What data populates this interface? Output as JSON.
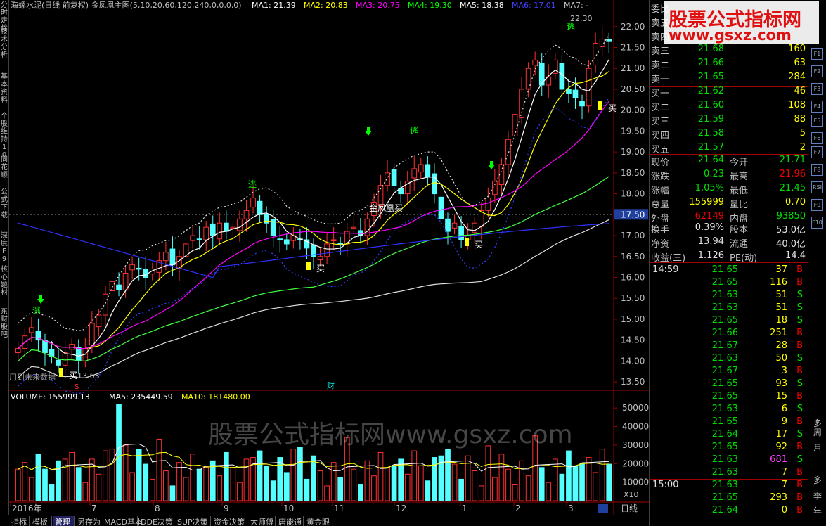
{
  "sidebar": {
    "tabs": [
      "分时走势",
      "技术分析",
      "基本资料",
      "个股维持10",
      "同花顺",
      "公式下载",
      "深度F9",
      "核心题材",
      "东财股吧"
    ]
  },
  "chart": {
    "title_line": "海螺水泥(日线 前复权) 金凤凰主图(5,10,20,60,120,240,0,0,0,0)",
    "ma_labels": [
      {
        "text": "MA1: 21.39",
        "color": "#ffffff"
      },
      {
        "text": "MA2: 20.83",
        "color": "#ffff00"
      },
      {
        "text": "MA3: 20.75",
        "color": "#ff00ff"
      },
      {
        "text": "MA4: 19.30",
        "color": "#00ff00"
      },
      {
        "text": "MA5: 18.38",
        "color": "#ffffff"
      },
      {
        "text": "MA6: 17.01",
        "color": "#4040ff"
      },
      {
        "text": "MA7: -",
        "color": "#c0c0c0"
      }
    ],
    "price_axis": [
      "22.00",
      "21.50",
      "21.00",
      "20.50",
      "20.00",
      "19.50",
      "19.00",
      "18.50",
      "18.00",
      "17.50",
      "17.00",
      "16.50",
      "16.00",
      "15.50",
      "15.00",
      "14.50",
      "14.00",
      "13.50"
    ],
    "current_price_tag": "17.50",
    "high_label": "22.30",
    "low_label": "13.63",
    "annotations": {
      "escape": "逃",
      "buy": "买",
      "phoenix_buy": "金凤凰买",
      "future_data": "用到未来数据",
      "finance_mark": "财",
      "s_mark": "S"
    },
    "volume_line": {
      "volume": "VOLUME: 155999.13",
      "ma5": "MA5: 235449.59",
      "ma10": "MA10: 181480.00"
    },
    "volume_axis": [
      "50000",
      "40000",
      "30000",
      "20000",
      "10000"
    ],
    "volume_unit": "X10",
    "time_axis": [
      "2016年",
      "7",
      "8",
      "9",
      "10",
      "11",
      "12",
      "1",
      "2",
      "3"
    ],
    "period": "日线",
    "overlay_text": "股票公式指标网www.gsxz.com"
  },
  "chart_data": {
    "type": "candlestick",
    "title": "海螺水泥(日线 前复权)",
    "ylim": [
      13.4,
      22.4
    ],
    "closes": [
      14.3,
      14.6,
      14.8,
      14.5,
      14.2,
      14.1,
      13.9,
      14.2,
      14.4,
      14.0,
      14.3,
      14.9,
      15.1,
      15.6,
      15.9,
      15.7,
      16.1,
      16.3,
      16.2,
      16.0,
      16.2,
      16.4,
      16.6,
      16.3,
      16.5,
      16.8,
      17.0,
      16.9,
      17.2,
      17.0,
      17.3,
      17.1,
      17.2,
      17.4,
      17.6,
      17.9,
      17.5,
      17.3,
      17.0,
      16.9,
      16.8,
      17.0,
      16.9,
      16.7,
      16.5,
      16.5,
      16.8,
      16.9,
      16.8,
      17.1,
      17.2,
      17.0,
      17.4,
      17.8,
      18.2,
      18.5,
      18.2,
      18.0,
      18.3,
      18.6,
      18.7,
      18.4,
      18.0,
      17.4,
      17.1,
      17.3,
      16.9,
      17.0,
      17.3,
      17.6,
      17.9,
      18.3,
      18.7,
      19.3,
      19.9,
      20.5,
      21.0,
      21.2,
      20.6,
      20.8,
      21.2,
      20.5,
      20.4,
      20.3,
      20.1,
      21.0,
      21.6,
      21.7,
      21.64
    ],
    "volume_axis_unit": "X10"
  },
  "orderbook": {
    "header_label": "委比",
    "asks": [
      {
        "label": "卖五",
        "price": "",
        "vol": ""
      },
      {
        "label": "卖四",
        "price": "",
        "vol": ""
      },
      {
        "label": "卖三",
        "price": "21.68",
        "vol": "160"
      },
      {
        "label": "卖二",
        "price": "21.66",
        "vol": "63"
      },
      {
        "label": "卖一",
        "price": "21.65",
        "vol": "284"
      }
    ],
    "bids": [
      {
        "label": "买一",
        "price": "21.62",
        "vol": "46"
      },
      {
        "label": "买二",
        "price": "21.60",
        "vol": "108"
      },
      {
        "label": "买三",
        "price": "21.59",
        "vol": "88"
      },
      {
        "label": "买四",
        "price": "21.58",
        "vol": "5"
      },
      {
        "label": "买五",
        "price": "21.57",
        "vol": "2"
      }
    ],
    "stats": [
      {
        "l1": "现价",
        "v1": "21.64",
        "c1": "grn",
        "l2": "今开",
        "v2": "21.71",
        "c2": "grn"
      },
      {
        "l1": "涨跌",
        "v1": "-0.23",
        "c1": "grn",
        "l2": "最高",
        "v2": "21.96",
        "c2": "ntr"
      },
      {
        "l1": "涨幅",
        "v1": "-1.05%",
        "c1": "grn",
        "l2": "最低",
        "v2": "21.45",
        "c2": "grn"
      },
      {
        "l1": "总量",
        "v1": "155999",
        "c1": "yel",
        "l2": "量比",
        "v2": "0.70",
        "c2": "yel"
      },
      {
        "l1": "外盘",
        "v1": "62149",
        "c1": "ntr",
        "l2": "内盘",
        "v2": "93850",
        "c2": "grn"
      }
    ],
    "stats2": [
      {
        "l1": "换手",
        "v1": "0.39%",
        "l2": "股本",
        "v2": "53.0亿"
      },
      {
        "l1": "净资",
        "v1": "13.94",
        "l2": "流通",
        "v2": "40.0亿"
      },
      {
        "l1": "收益(三)",
        "v1": "1.126",
        "l2": "PE(动)",
        "v2": "14.4"
      }
    ]
  },
  "ticks": [
    {
      "time": "14:59",
      "price": "21.65",
      "vol": "37",
      "side": "B"
    },
    {
      "time": "",
      "price": "21.65",
      "vol": "116",
      "side": "B"
    },
    {
      "time": "",
      "price": "21.63",
      "vol": "51",
      "side": "S"
    },
    {
      "time": "",
      "price": "21.63",
      "vol": "51",
      "side": "S"
    },
    {
      "time": "",
      "price": "21.65",
      "vol": "18",
      "side": "S"
    },
    {
      "time": "",
      "price": "21.66",
      "vol": "251",
      "side": "B"
    },
    {
      "time": "",
      "price": "21.67",
      "vol": "28",
      "side": "B"
    },
    {
      "time": "",
      "price": "21.63",
      "vol": "50",
      "side": "S"
    },
    {
      "time": "",
      "price": "21.67",
      "vol": "3",
      "side": "B"
    },
    {
      "time": "",
      "price": "21.65",
      "vol": "93",
      "side": "S"
    },
    {
      "time": "",
      "price": "21.65",
      "vol": "15",
      "side": "B"
    },
    {
      "time": "",
      "price": "21.63",
      "vol": "6",
      "side": "S"
    },
    {
      "time": "",
      "price": "21.65",
      "vol": "9",
      "side": "B"
    },
    {
      "time": "",
      "price": "21.64",
      "vol": "17",
      "side": "S"
    },
    {
      "time": "",
      "price": "21.65",
      "vol": "92",
      "side": "B"
    },
    {
      "time": "",
      "price": "21.63",
      "vol": "681",
      "side": "S"
    },
    {
      "time": "",
      "price": "21.63",
      "vol": "7",
      "side": "B"
    },
    {
      "time": "15:00",
      "price": "21.63",
      "vol": "7",
      "side": "B"
    },
    {
      "time": "",
      "price": "21.65",
      "vol": "293",
      "side": "B"
    },
    {
      "time": "",
      "price": "21.64",
      "vol": "0",
      "side": "B"
    }
  ],
  "icon_column": {
    "icons": [
      "F1",
      "F2",
      "F3",
      "F4",
      "F5",
      "F6",
      "F7",
      "F8",
      "RSI",
      "F9",
      "F10"
    ],
    "chars": [
      "多",
      "周",
      "月",
      "多",
      "季",
      "年"
    ]
  },
  "bottom_tabs": [
    "指标",
    "模板",
    "管理",
    "另存为",
    "MACD基本",
    "DDE决策",
    "SUP决策",
    "资金决策",
    "大师傅",
    "唐能通",
    "黄金眼"
  ],
  "watermark": {
    "line1": "股票公式指标网",
    "line2": "www.gsxz.com"
  }
}
